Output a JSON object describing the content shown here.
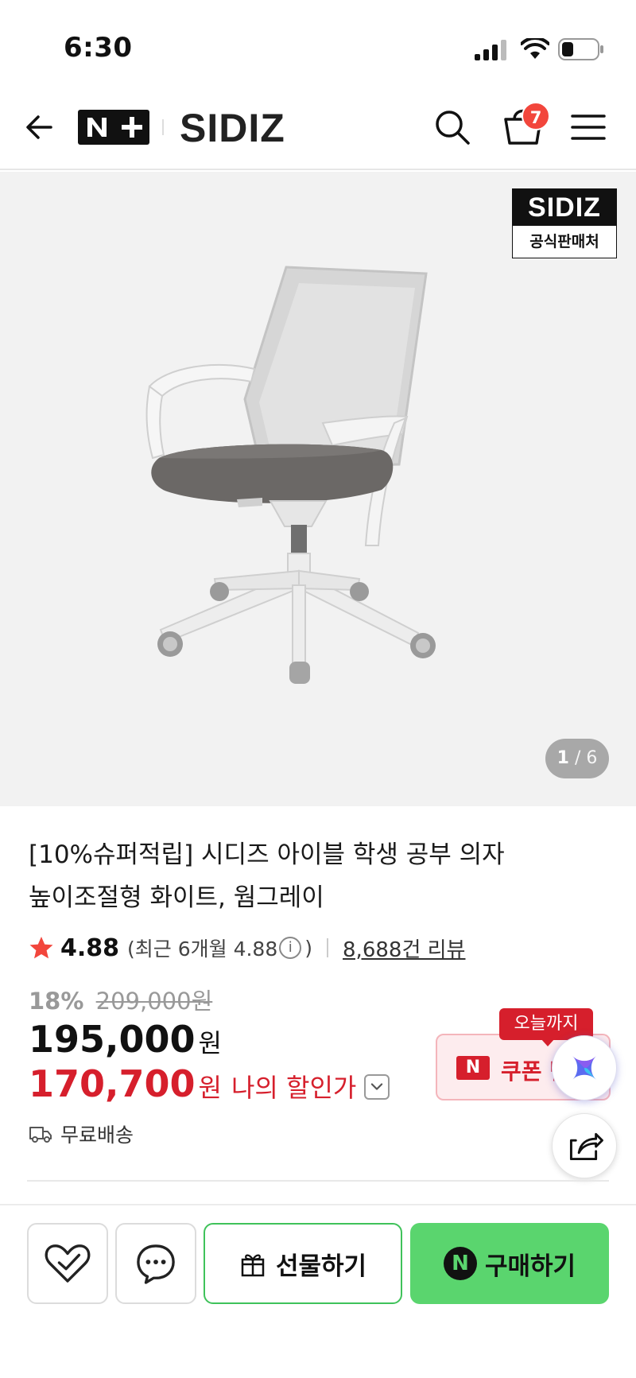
{
  "status_bar": {
    "time": "6:30"
  },
  "header": {
    "brand_logo": "N+",
    "brand_name": "SIDIZ",
    "cart_count": "7"
  },
  "gallery": {
    "official_badge_brand": "SIDIZ",
    "official_badge_label": "공식판매처",
    "current_page": "1",
    "page_sep": "/",
    "total_pages": "6"
  },
  "product": {
    "title_line1": "[10%슈퍼적립] 시디즈 아이블 학생 공부 의자",
    "title_line2": "높이조절형 화이트, 웜그레이",
    "rating": "4.88",
    "recent_rating_prefix": "(최근 6개월 4.88",
    "recent_rating_suffix": ")",
    "info_icon": "i",
    "review_count": "8,688건 리뷰",
    "discount_rate": "18%",
    "original_price": "209,000원",
    "price": "195,000",
    "price_unit": "원",
    "my_price": "170,700",
    "my_price_unit": "원",
    "my_price_label": "나의 할인가",
    "shipping": "무료배송"
  },
  "coupon": {
    "tag": "오늘까지",
    "n_mark": "N",
    "label": "쿠폰 받"
  },
  "bottom_bar": {
    "gift_label": "선물하기",
    "buy_icon": "N",
    "buy_label": "구매하기"
  },
  "colors": {
    "accent_red": "#d61f2c",
    "npay_green": "#5ad56e",
    "badge_red": "#f2463c"
  }
}
